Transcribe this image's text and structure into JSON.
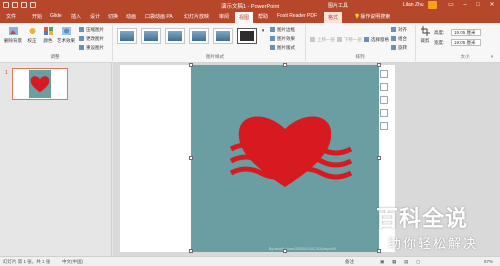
{
  "titlebar": {
    "title": "演示文稿1 - PowerPoint",
    "context": "图片工具",
    "user": "Lilan Zhu",
    "avatar_color": "#f7a11a"
  },
  "tabs": [
    "文件",
    "开始",
    "Glide",
    "插入",
    "设计",
    "切换",
    "动画",
    "口袋动画 PA",
    "幻灯片放映",
    "审阅",
    "视图",
    "帮助",
    "Foxit Reader PDF",
    "格式",
    "操作说明搜索"
  ],
  "ribbon": {
    "adjust": {
      "remove_bg": "删除背景",
      "corrections": "校正",
      "color": "颜色",
      "art_effects": "艺术效果",
      "compress": "压缩图片",
      "change": "更改图片",
      "reset": "重设图片",
      "group_label": "调整"
    },
    "styles": {
      "border": "图片边框",
      "effects": "图片效果",
      "layout": "图片版式",
      "group_label": "图片样式"
    },
    "arrange": {
      "bring_forward": "上移一层",
      "send_backward": "下移一层",
      "selection_pane": "选择窗格",
      "align": "对齐",
      "group": "组合",
      "rotate": "旋转",
      "group_label": "排列"
    },
    "size": {
      "crop": "裁剪",
      "height_label": "高度:",
      "height_value": "19.05 厘米",
      "width_label": "宽度:",
      "width_value": "19.05 厘米",
      "group_label": "大小"
    }
  },
  "slide_pane": {
    "slide_number": "1"
  },
  "canvas": {
    "watermark": "Byviewrillo bmm/2025/01/0017401/bnp/n90"
  },
  "status": {
    "slide_info": "幻灯片 第 1 张，共 1 张",
    "language": "中文(中国)",
    "notes": "备注",
    "zoom": "67%"
  },
  "brand": {
    "name": "百科全说",
    "slogan": "助你轻松解决"
  },
  "colors": {
    "accent": "#b7472a",
    "picture_bg": "#6a9ea3",
    "heart": "#d71a1f"
  }
}
